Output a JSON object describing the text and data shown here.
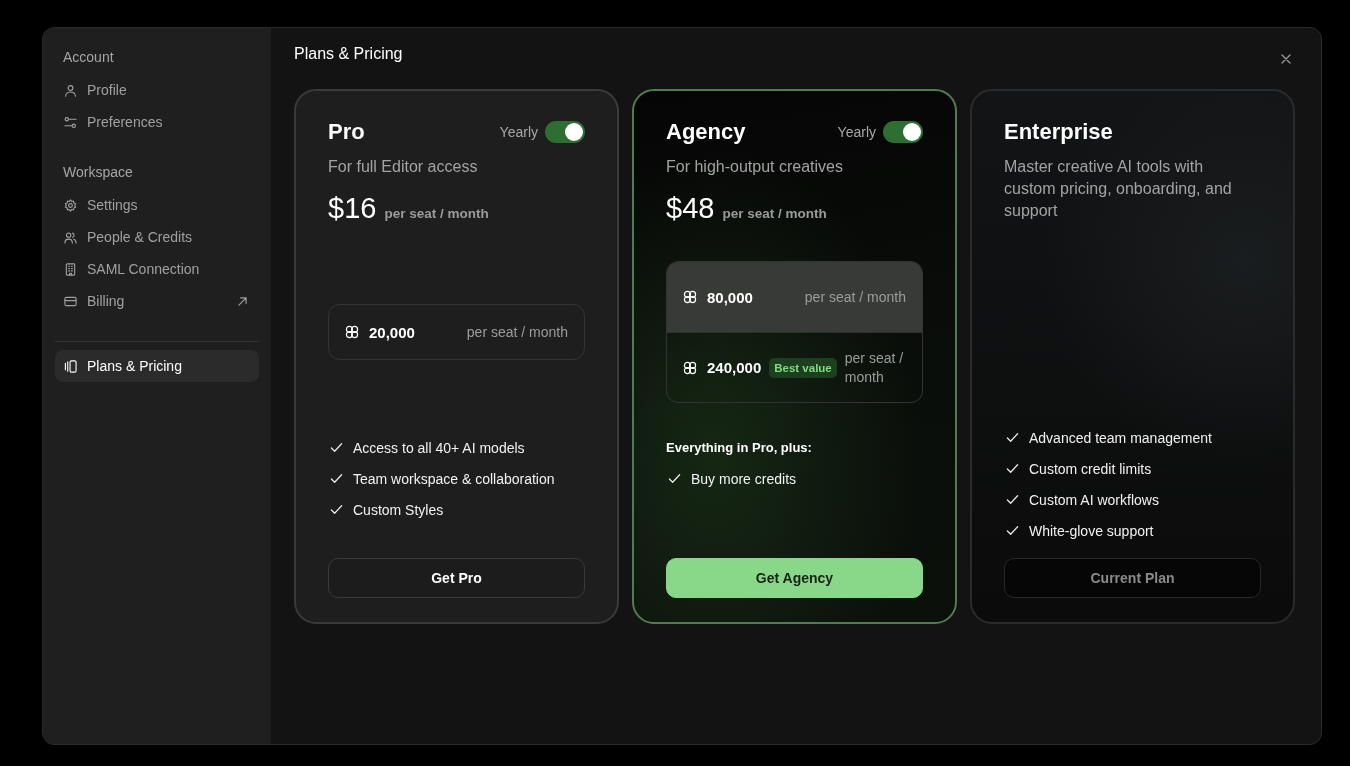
{
  "sidebar": {
    "sections": [
      {
        "title": "Account",
        "items": [
          {
            "label": "Profile",
            "selected": false,
            "external": false
          },
          {
            "label": "Preferences",
            "selected": false,
            "external": false
          }
        ]
      },
      {
        "title": "Workspace",
        "items": [
          {
            "label": "Settings",
            "selected": false,
            "external": false
          },
          {
            "label": "People & Credits",
            "selected": false,
            "external": false
          },
          {
            "label": "SAML Connection",
            "selected": false,
            "external": false
          },
          {
            "label": "Billing",
            "selected": false,
            "external": true
          }
        ]
      }
    ],
    "footer_items": [
      {
        "label": "Plans & Pricing",
        "selected": true,
        "external": false
      }
    ]
  },
  "main": {
    "title": "Plans & Pricing"
  },
  "plans": [
    {
      "kind": "plain",
      "name": "Pro",
      "toggle": {
        "label": "Yearly",
        "on": true
      },
      "description": "For full Editor access",
      "price": "$16",
      "price_unit": "per seat / month",
      "credit_options": [
        {
          "amount": "20,000",
          "unit": "per seat / month",
          "selected": false
        }
      ],
      "features": [
        "Access to all 40+ AI models",
        "Team workspace & collaboration",
        "Custom Styles"
      ],
      "button": {
        "label": "Get Pro",
        "kind": "outline",
        "disabled": false
      }
    },
    {
      "kind": "featured",
      "name": "Agency",
      "toggle": {
        "label": "Yearly",
        "on": true
      },
      "description": "For high-output creatives",
      "price": "$48",
      "price_unit": "per seat / month",
      "credit_options": [
        {
          "amount": "80,000",
          "unit": "per seat / month",
          "selected": true
        },
        {
          "amount": "240,000",
          "badge": "Best value",
          "unit": "per seat / month",
          "selected": false
        }
      ],
      "features_heading": "Everything in Pro, plus:",
      "features": [
        "Buy more credits"
      ],
      "button": {
        "label": "Get Agency",
        "kind": "primary",
        "disabled": false
      }
    },
    {
      "kind": "dark",
      "name": "Enterprise",
      "description": "Master creative AI tools with custom pricing, onboarding, and support",
      "features": [
        "Advanced team management",
        "Custom credit limits",
        "Custom AI workflows",
        "White-glove support"
      ],
      "button": {
        "label": "Current Plan",
        "kind": "outline",
        "disabled": true
      }
    }
  ]
}
